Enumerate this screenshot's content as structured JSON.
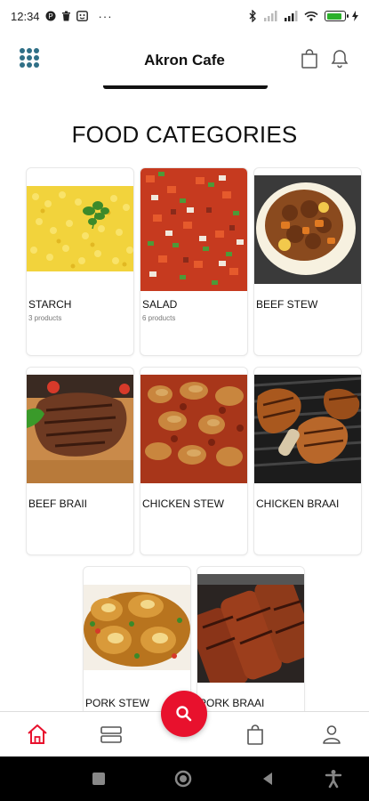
{
  "status_bar": {
    "time": "12:34",
    "more": "···",
    "battery_color": "#2bb02b"
  },
  "header": {
    "title": "Akron Cafe",
    "menu_icon": "grid-menu-icon",
    "cart_icon": "shopping-bag-icon",
    "notification_icon": "bell-icon"
  },
  "section": {
    "title": "FOOD CATEGORIES"
  },
  "categories": [
    {
      "name": "STARCH",
      "count": "3 products",
      "image": "starch-image"
    },
    {
      "name": "SALAD",
      "count": "6 products",
      "image": "salad-image"
    },
    {
      "name": "BEEF STEW",
      "count": "",
      "image": "beef-stew-image"
    },
    {
      "name": "BEEF BRAII",
      "count": "",
      "image": "beef-braii-image"
    },
    {
      "name": "CHICKEN STEW",
      "count": "",
      "image": "chicken-stew-image"
    },
    {
      "name": "CHICKEN BRAAI",
      "count": "",
      "image": "chicken-braai-image"
    },
    {
      "name": "PORK STEW",
      "count": "",
      "image": "pork-stew-image"
    },
    {
      "name": "PORK BRAAI",
      "count": "",
      "image": "pork-braai-image"
    }
  ],
  "bottom_nav": {
    "items": [
      "home-icon",
      "categories-icon",
      "search-icon",
      "cart-icon",
      "profile-icon"
    ],
    "active_color": "#e8112d"
  },
  "system_nav": {
    "items": [
      "recent-apps-icon",
      "home-circle-icon",
      "back-icon",
      "accessibility-icon"
    ]
  }
}
